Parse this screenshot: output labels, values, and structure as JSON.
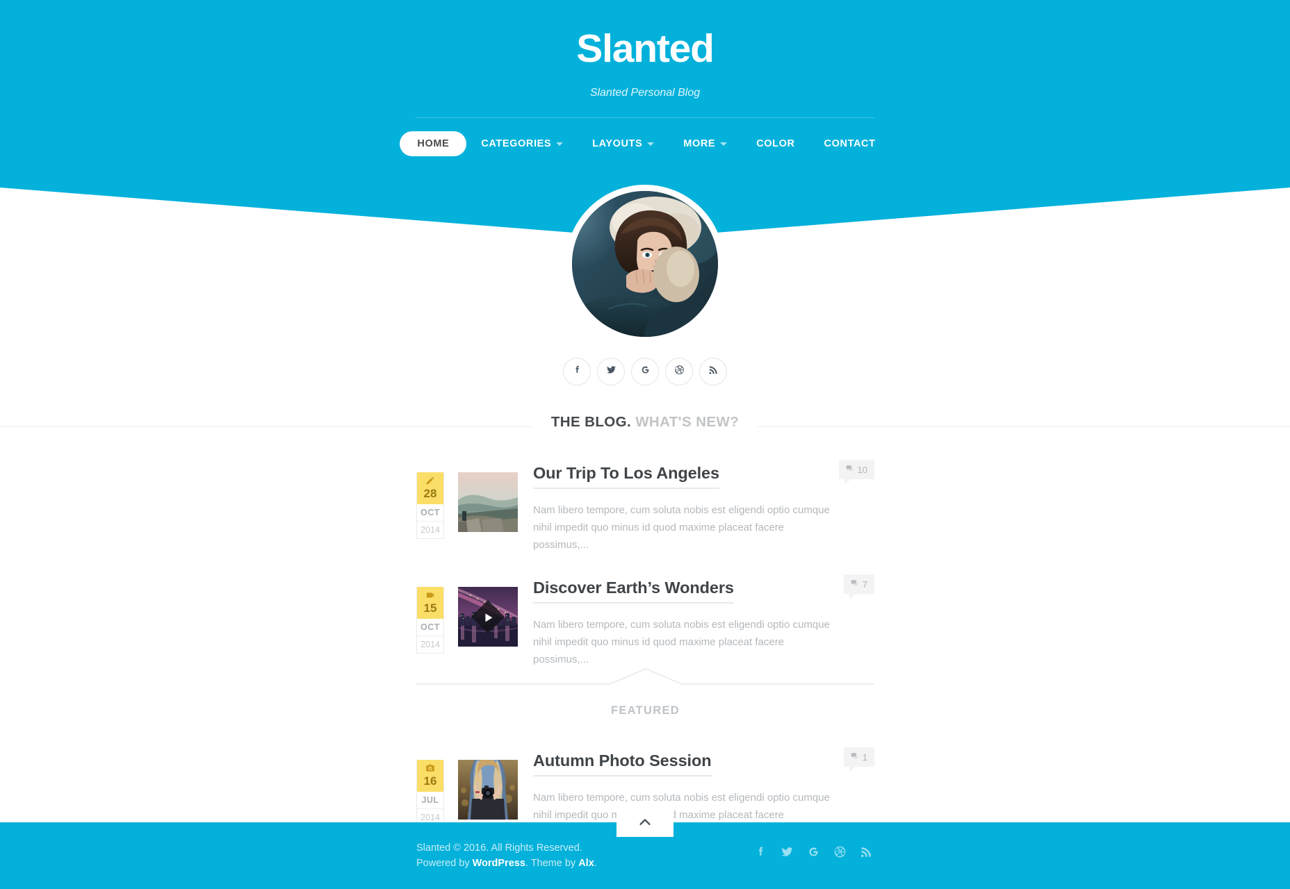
{
  "site": {
    "title": "Slanted",
    "tagline": "Slanted Personal Blog",
    "accent_color": "#03b1db",
    "badge_color": "#fade68"
  },
  "nav": {
    "items": [
      {
        "label": "HOME",
        "has_caret": false,
        "active": true
      },
      {
        "label": "CATEGORIES",
        "has_caret": true,
        "active": false
      },
      {
        "label": "LAYOUTS",
        "has_caret": true,
        "active": false
      },
      {
        "label": "MORE",
        "has_caret": true,
        "active": false
      },
      {
        "label": "COLOR",
        "has_caret": false,
        "active": false
      },
      {
        "label": "CONTACT",
        "has_caret": false,
        "active": false
      }
    ]
  },
  "avatar": {
    "alt": "author-portrait"
  },
  "social": {
    "items": [
      {
        "name": "facebook-icon"
      },
      {
        "name": "twitter-icon"
      },
      {
        "name": "google-icon"
      },
      {
        "name": "dribbble-icon"
      },
      {
        "name": "rss-icon"
      }
    ]
  },
  "section": {
    "heading_strong": "THE BLOG.",
    "heading_muted": "WHAT'S NEW?"
  },
  "featured": {
    "label": "FEATURED"
  },
  "posts": [
    {
      "format_icon": "pencil-icon",
      "day": "28",
      "month": "OCT",
      "year": "2014",
      "title": "Our Trip To Los Angeles",
      "excerpt": "Nam libero tempore, cum soluta nobis est eligendi optio cumque nihil impedit quo minus id quod maxime placeat facere possimus,...",
      "comments": "10",
      "has_play": false
    },
    {
      "format_icon": "video-icon",
      "day": "15",
      "month": "OCT",
      "year": "2014",
      "title": "Discover Earth’s Wonders",
      "excerpt": "Nam libero tempore, cum soluta nobis est eligendi optio cumque nihil impedit quo minus id quod maxime placeat facere possimus,...",
      "comments": "7",
      "has_play": true
    },
    {
      "format_icon": "camera-icon",
      "day": "16",
      "month": "JUL",
      "year": "2014",
      "title": "Autumn Photo Session",
      "excerpt": "Nam libero tempore, cum soluta nobis est eligendi optio cumque nihil impedit quo minus id quod maxime placeat facere possimus,...",
      "comments": "1",
      "has_play": false
    }
  ],
  "footer": {
    "copyright": "Slanted © 2016. All Rights Reserved.",
    "powered_prefix": "Powered by ",
    "powered_link": "WordPress",
    "theme_prefix": ". Theme by ",
    "theme_link": "Alx",
    "theme_suffix": ".",
    "to_top": "back-to-top",
    "social": [
      {
        "name": "facebook-icon"
      },
      {
        "name": "twitter-icon"
      },
      {
        "name": "google-icon"
      },
      {
        "name": "dribbble-icon"
      },
      {
        "name": "rss-icon"
      }
    ]
  }
}
